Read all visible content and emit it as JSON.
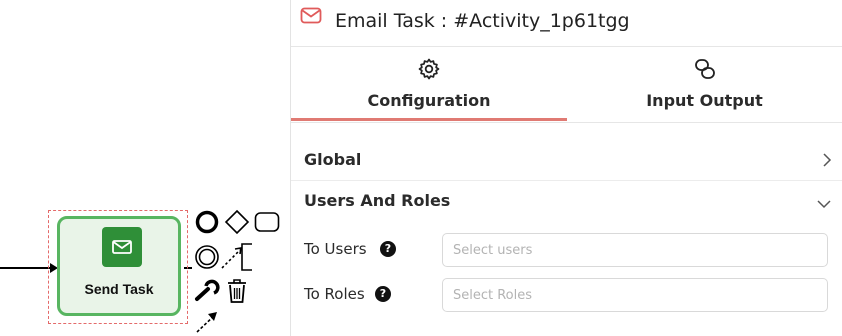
{
  "canvas": {
    "task": {
      "label": "Send Task",
      "icon": "envelope-icon",
      "fill": "#e9f4e8",
      "border": "#58b561",
      "icon_bg": "#2f8f38"
    },
    "context_pad": [
      "end-event-icon",
      "gateway-icon",
      "task-icon",
      "intermediate-event-icon",
      "connect-icon",
      "text-annotation-icon",
      "wrench-icon",
      "trash-icon",
      "sequence-flow-icon"
    ]
  },
  "panel": {
    "header": {
      "icon": "envelope-icon",
      "title": "Email Task : #Activity_1p61tgg",
      "accent": "#e05a5a"
    },
    "tabs": [
      {
        "label": "Configuration",
        "icon": "gear-icon",
        "active": true
      },
      {
        "label": "Input Output",
        "icon": "link-icon",
        "active": false
      }
    ],
    "tab_accent": "#e07a73",
    "sections": {
      "global": {
        "title": "Global",
        "expanded": false
      },
      "users_and_roles": {
        "title": "Users And Roles",
        "expanded": true
      }
    },
    "fields": {
      "to_users": {
        "label": "To Users",
        "placeholder": "Select users",
        "value": ""
      },
      "to_roles": {
        "label": "To Roles",
        "placeholder": "Select Roles",
        "value": ""
      }
    }
  }
}
